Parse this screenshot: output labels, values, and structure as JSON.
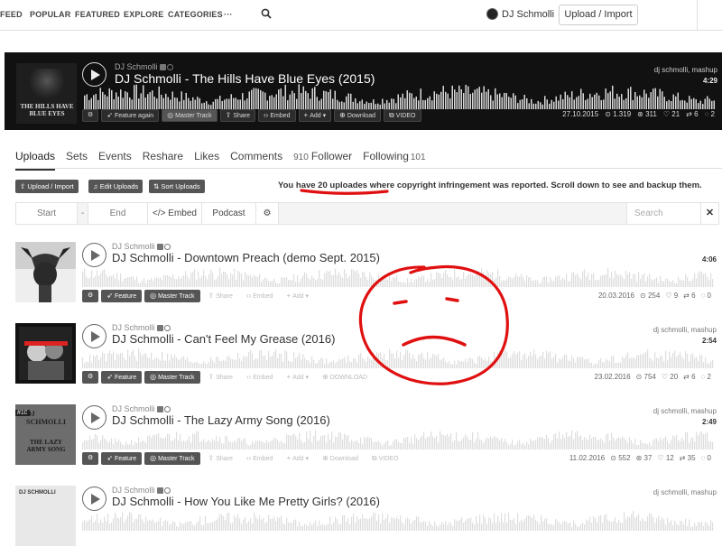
{
  "nav": {
    "items": [
      "FEED",
      "POPULAR",
      "FEATURED",
      "EXPLORE",
      "CATEGORIES",
      "···"
    ],
    "user_name": "DJ Schmolli",
    "upload_label": "Upload / Import"
  },
  "featured": {
    "artist": "DJ Schmolli",
    "title": "DJ Schmolli - The Hills Have Blue Eyes (2015)",
    "art_text": "THE HILLS HAVE BLUE EYES",
    "tags": "dj schmolli, mashup",
    "duration": "4:29",
    "buttons": [
      "Feature again",
      "Master Track",
      "Share",
      "Embed",
      "Add",
      "Download",
      "VIDEO"
    ],
    "date": "27.10.2015",
    "plays": "1.319",
    "likes_a": "311",
    "likes": "21",
    "reposts": "6",
    "comments": "2"
  },
  "tabs": [
    {
      "label": "Uploads",
      "count": ""
    },
    {
      "label": "Sets",
      "count": ""
    },
    {
      "label": "Events",
      "count": ""
    },
    {
      "label": "Reshare",
      "count": ""
    },
    {
      "label": "Likes",
      "count": ""
    },
    {
      "label": "Comments",
      "count": ""
    },
    {
      "label": "Follower",
      "count": "910"
    },
    {
      "label": "Following",
      "count": "101"
    }
  ],
  "tools": {
    "upload": "Upload / Import",
    "edit": "Edit Uploads",
    "sort": "Sort Uploads"
  },
  "notice": {
    "prefix": "You ",
    "highlight": "have 20 uploades where",
    "suffix": " copyright infringement was reported. Scroll down to see and backup them."
  },
  "filter": {
    "start": "Start",
    "dash": "-",
    "end": "End",
    "embed": "</> Embed",
    "podcast": "Podcast",
    "search_placeholder": "Search",
    "close": "✕"
  },
  "tracks": [
    {
      "artist": "DJ Schmolli",
      "title": "DJ Schmolli - Downtown Preach (demo Sept. 2015)",
      "tags": "",
      "duration": "4:06",
      "buttons": [
        "Feature",
        "Master Track",
        "Share",
        "Embed",
        "Add"
      ],
      "date": "20.03.2016",
      "plays": "254",
      "likes": "9",
      "reposts": "6",
      "comments": "0"
    },
    {
      "artist": "DJ Schmolli",
      "title": "DJ Schmolli - Can't Feel My Grease (2016)",
      "tags": "dj schmolli, mashup",
      "duration": "2:54",
      "buttons": [
        "Feature",
        "Master Track",
        "Share",
        "Embed",
        "Add",
        "DOWNLOAD"
      ],
      "date": "23.02.2016",
      "plays": "754",
      "likes": "20",
      "reposts": "6",
      "comments": "2"
    },
    {
      "artist": "DJ Schmolli",
      "title": "DJ Schmolli - The Lazy Army Song (2016)",
      "tags": "dj schmolli, mashup",
      "duration": "2:49",
      "art_text": "DJ SCHMOLLI",
      "art_num": "#10",
      "art_sub": "THE LAZY ARMY SONG",
      "buttons": [
        "Feature",
        "Master Track",
        "Share",
        "Embed",
        "Add",
        "Download",
        "VIDEO"
      ],
      "date": "11.02.2016",
      "plays": "552",
      "likes_a": "37",
      "likes": "12",
      "reposts": "35",
      "comments": "0"
    },
    {
      "artist": "DJ Schmolli",
      "title": "DJ Schmolli - How You Like Me Pretty Girls? (2016)",
      "tags": "dj schmolli, mashup",
      "duration": "",
      "art_text": "DJ SCHMOLLI",
      "buttons": [],
      "date": "",
      "plays": "",
      "likes": "",
      "reposts": "",
      "comments": ""
    }
  ],
  "colors": {
    "annotation_red": "#e01010",
    "hero_bg": "#111111",
    "button_bg": "#555555"
  }
}
